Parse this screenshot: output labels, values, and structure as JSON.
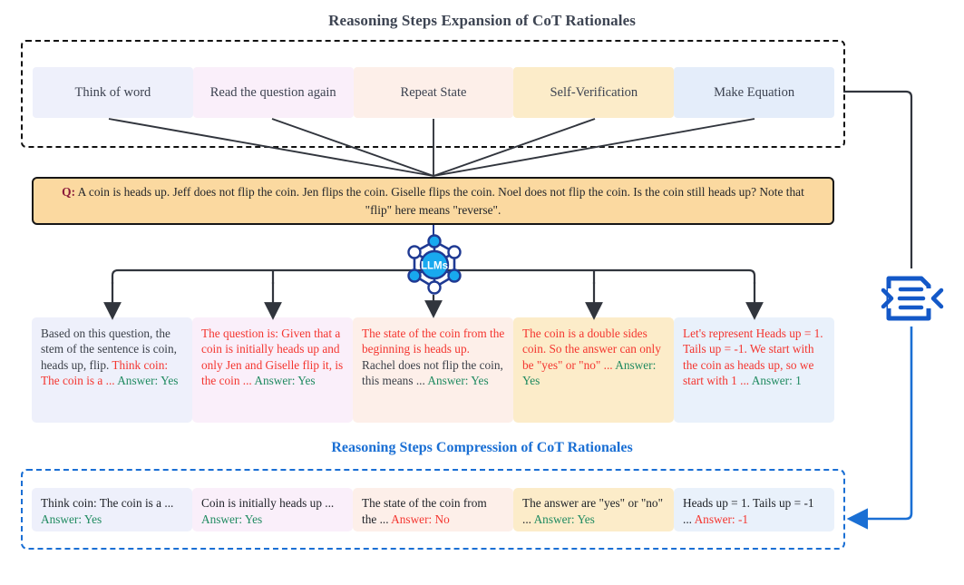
{
  "titles": {
    "expansion": "Reasoning Steps Expansion of CoT Rationales",
    "compression": "Reasoning Steps Compression of CoT Rationales"
  },
  "colors": {
    "expansion_title": "#3d4452",
    "compression_title": "#1a6fd4",
    "question_bg": "#fbd9a0",
    "question_border": "#161616",
    "dashed_top": "#111111",
    "dashed_bottom": "#1a6fd4",
    "llm_blue": "#18a9ef",
    "llm_navy": "#1f3a93",
    "doc_blue": "#1358c8",
    "connector_black": "#31353d",
    "connector_blue": "#1a6fd4",
    "answer_green": "#1f8a60",
    "answer_red": "#f4352f",
    "text_red": "#f4352f",
    "text_gray": "#3a3f48"
  },
  "steps": [
    {
      "label": "Think of word",
      "bg": "#eef0fb"
    },
    {
      "label": "Read the question again",
      "bg": "#faeffa"
    },
    {
      "label": "Repeat State",
      "bg": "#fdefe9"
    },
    {
      "label": "Self-Verification",
      "bg": "#fcecc9"
    },
    {
      "label": "Make Equation",
      "bg": "#e4edfa"
    }
  ],
  "question": {
    "prefix": "Q:",
    "text": " A coin is heads up. Jeff does not flip the coin. Jen flips the coin. Giselle flips the coin. Noel does not flip the coin. Is the coin still heads up? Note that \"flip\" here means \"reverse\"."
  },
  "llm_icon": {
    "label": "LLMs"
  },
  "rationales": [
    {
      "bg": "#eef0fb",
      "segments": [
        {
          "text": "Based on this question, the stem of the sentence is coin, heads up, flip. ",
          "color": "gray"
        },
        {
          "text": "Think coin: The coin is a ... ",
          "color": "red"
        },
        {
          "text": "Answer: Yes",
          "color": "green"
        }
      ]
    },
    {
      "bg": "#faeffa",
      "segments": [
        {
          "text": "The question is: Given that a coin is initially heads up and only Jen and Giselle flip it, is the coin ... ",
          "color": "red"
        },
        {
          "text": "Answer: Yes",
          "color": "green"
        }
      ]
    },
    {
      "bg": "#fdefe9",
      "segments": [
        {
          "text": "The state of the coin from the beginning is heads up.",
          "color": "red"
        },
        {
          "text": " Rachel does not flip the coin, this means ... ",
          "color": "gray"
        },
        {
          "text": "Answer: Yes",
          "color": "green"
        }
      ]
    },
    {
      "bg": "#fcecc9",
      "segments": [
        {
          "text": "The coin is a double sides coin. So the answer can only be \"yes\" or \"no\" ... ",
          "color": "red"
        },
        {
          "text": "Answer: Yes",
          "color": "green"
        }
      ]
    },
    {
      "bg": "#e9f1fb",
      "segments": [
        {
          "text": "Let's represent Heads up = 1. Tails up = -1. We start with the coin as heads up, so we start with 1 ... ",
          "color": "red"
        },
        {
          "text": "Answer: 1",
          "color": "green"
        }
      ]
    }
  ],
  "compressed": [
    {
      "bg": "#eef0fb",
      "segments": [
        {
          "text": "Think coin: The coin is a ... ",
          "color": "black"
        },
        {
          "text": "Answer: Yes",
          "color": "green"
        }
      ]
    },
    {
      "bg": "#faeffa",
      "segments": [
        {
          "text": "Coin is initially heads up ... ",
          "color": "black"
        },
        {
          "text": "Answer: Yes",
          "color": "green"
        }
      ]
    },
    {
      "bg": "#fdefe9",
      "segments": [
        {
          "text": "The state of the coin from the ... ",
          "color": "black"
        },
        {
          "text": "Answer: No",
          "color": "red"
        }
      ]
    },
    {
      "bg": "#fcecc9",
      "segments": [
        {
          "text": "The answer are \"yes\" or \"no\" ... ",
          "color": "black"
        },
        {
          "text": "Answer: Yes",
          "color": "green"
        }
      ]
    },
    {
      "bg": "#e9f1fb",
      "segments": [
        {
          "text": "Heads up = 1. Tails up = -1 ... ",
          "color": "black"
        },
        {
          "text": "Answer: -1",
          "color": "red"
        }
      ]
    }
  ],
  "doc_icon": {
    "name": "document-compression-icon"
  }
}
